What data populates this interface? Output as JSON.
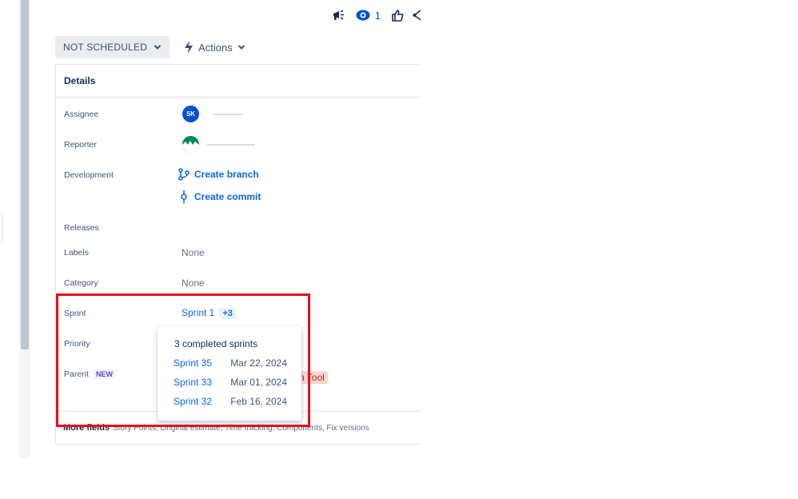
{
  "toolbar": {
    "watchers_count": "1"
  },
  "status": {
    "label": "NOT SCHEDULED",
    "actions_label": "Actions"
  },
  "details": {
    "title": "Details",
    "assignee": {
      "label": "Assignee",
      "avatar_initials": "SK"
    },
    "reporter": {
      "label": "Reporter"
    },
    "development": {
      "label": "Development",
      "create_branch": "Create branch",
      "create_commit": "Create commit"
    },
    "releases": {
      "label": "Releases"
    },
    "labels": {
      "label": "Labels",
      "value": "None"
    },
    "category": {
      "label": "Category",
      "value": "None"
    },
    "sprint": {
      "label": "Sprint",
      "value": "Sprint 1",
      "extra": "+3"
    },
    "priority": {
      "label": "Priority"
    },
    "parent": {
      "label": "Parent",
      "badge": "NEW",
      "value_fragment": "n Tool"
    }
  },
  "more_fields": {
    "title": "More fields",
    "description": "Story Points, Original estimate, Time tracking, Components, Fix versions"
  },
  "sprint_popup": {
    "title": "3 completed sprints",
    "sprints": [
      {
        "name": "Sprint 35",
        "date": "Mar 22, 2024"
      },
      {
        "name": "Sprint 33",
        "date": "Mar 01, 2024"
      },
      {
        "name": "Sprint 32",
        "date": "Feb 16, 2024"
      }
    ]
  },
  "colors": {
    "link": "#0c66e4",
    "highlight": "#e3101c",
    "status_bg": "#ebecf0"
  },
  "icons": [
    "megaphone-icon",
    "eye-icon",
    "thumbs-up-icon",
    "share-icon",
    "chevron-down-icon",
    "lightning-icon",
    "branch-icon",
    "commit-icon"
  ]
}
